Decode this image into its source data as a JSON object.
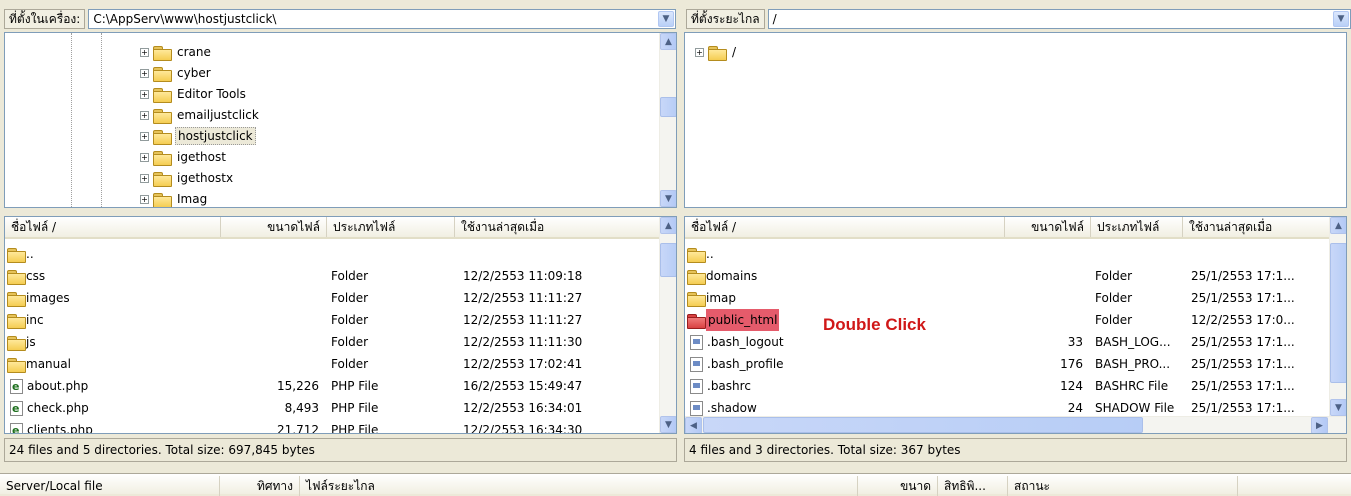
{
  "local": {
    "path_label": "ที่ตั้งในเครื่อง:",
    "path_value": "C:\\AppServ\\www\\hostjustclick\\",
    "tree": [
      "crane",
      "cyber",
      "Editor Tools",
      "emailjustclick",
      "hostjustclick",
      "igethost",
      "igethostx",
      "Imag"
    ],
    "tree_selected": "hostjustclick",
    "columns": [
      "ชื่อไฟล์ /",
      "ขนาดไฟล์",
      "ประเภทไฟล์",
      "ใช้งานล่าสุดเมื่อ"
    ],
    "files": [
      {
        "name": "..",
        "size": "",
        "type": "",
        "modified": "",
        "icon": "folder"
      },
      {
        "name": "css",
        "size": "",
        "type": "Folder",
        "modified": "12/2/2553 11:09:18",
        "icon": "folder"
      },
      {
        "name": "images",
        "size": "",
        "type": "Folder",
        "modified": "12/2/2553 11:11:27",
        "icon": "folder"
      },
      {
        "name": "inc",
        "size": "",
        "type": "Folder",
        "modified": "12/2/2553 11:11:27",
        "icon": "folder"
      },
      {
        "name": "js",
        "size": "",
        "type": "Folder",
        "modified": "12/2/2553 11:11:30",
        "icon": "folder"
      },
      {
        "name": "manual",
        "size": "",
        "type": "Folder",
        "modified": "12/2/2553 17:02:41",
        "icon": "folder"
      },
      {
        "name": "about.php",
        "size": "15,226",
        "type": "PHP File",
        "modified": "16/2/2553 15:49:47",
        "icon": "php"
      },
      {
        "name": "check.php",
        "size": "8,493",
        "type": "PHP File",
        "modified": "12/2/2553 16:34:01",
        "icon": "php"
      },
      {
        "name": "clients.php",
        "size": "21,712",
        "type": "PHP File",
        "modified": "12/2/2553 16:34:30",
        "icon": "php"
      }
    ],
    "status": "24 files and 5 directories. Total size: 697,845 bytes"
  },
  "remote": {
    "path_label": "ที่ตั้งระยะไกล",
    "path_value": "/",
    "tree": [
      "/"
    ],
    "columns": [
      "ชื่อไฟล์ /",
      "ขนาดไฟล์",
      "ประเภทไฟล์",
      "ใช้งานล่าสุดเมื่อ"
    ],
    "files": [
      {
        "name": "..",
        "size": "",
        "type": "",
        "modified": "",
        "icon": "folder"
      },
      {
        "name": "domains",
        "size": "",
        "type": "Folder",
        "modified": "25/1/2553 17:1...",
        "icon": "folder"
      },
      {
        "name": "imap",
        "size": "",
        "type": "Folder",
        "modified": "25/1/2553 17:1...",
        "icon": "folder"
      },
      {
        "name": "public_html",
        "size": "",
        "type": "Folder",
        "modified": "12/2/2553 17:0...",
        "icon": "folder-red"
      },
      {
        "name": ".bash_logout",
        "size": "33",
        "type": "BASH_LOG...",
        "modified": "25/1/2553 17:1...",
        "icon": "txt"
      },
      {
        "name": ".bash_profile",
        "size": "176",
        "type": "BASH_PRO...",
        "modified": "25/1/2553 17:1...",
        "icon": "txt"
      },
      {
        "name": ".bashrc",
        "size": "124",
        "type": "BASHRC File",
        "modified": "25/1/2553 17:1...",
        "icon": "txt"
      },
      {
        "name": ".shadow",
        "size": "24",
        "type": "SHADOW File",
        "modified": "25/1/2553 17:1...",
        "icon": "txt"
      }
    ],
    "status": "4 files and 3 directories. Total size: 367 bytes",
    "annotation": "Double Click"
  },
  "queue": {
    "columns": [
      "Server/Local file",
      "ทิศทาง",
      "ไฟล์ระยะไกล",
      "ขนาด",
      "สิทธิพิ...",
      "สถานะ"
    ]
  }
}
